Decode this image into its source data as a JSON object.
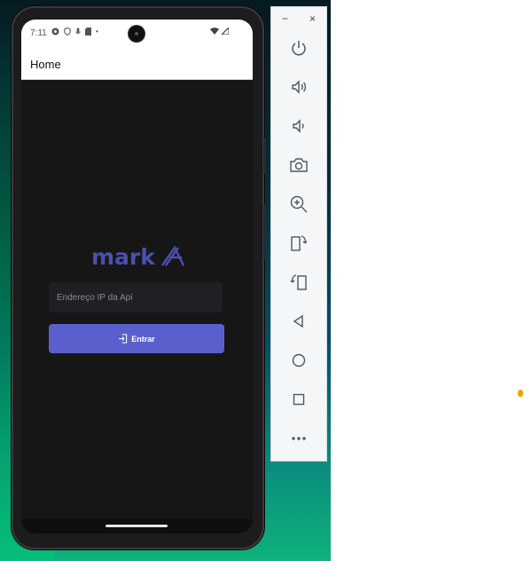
{
  "status_bar": {
    "time": "7:11"
  },
  "app": {
    "title": "Home",
    "logo_text": "markX",
    "ip_field": {
      "placeholder": "Endereço IP da Api",
      "value": ""
    },
    "enter_button_label": "Entrar"
  },
  "emulator_toolbar": {
    "window_controls": [
      "−",
      "×"
    ],
    "buttons": [
      {
        "name": "power-icon",
        "label": "Power"
      },
      {
        "name": "volume-up-icon",
        "label": "Volume up"
      },
      {
        "name": "volume-down-icon",
        "label": "Volume down"
      },
      {
        "name": "camera-icon",
        "label": "Take screenshot"
      },
      {
        "name": "zoom-icon",
        "label": "Zoom"
      },
      {
        "name": "rotate-left-icon",
        "label": "Rotate left"
      },
      {
        "name": "rotate-right-icon",
        "label": "Rotate right"
      },
      {
        "name": "back-icon",
        "label": "Back"
      },
      {
        "name": "home-icon",
        "label": "Home"
      },
      {
        "name": "overview-icon",
        "label": "Overview"
      },
      {
        "name": "more-icon",
        "label": "More"
      }
    ]
  },
  "colors": {
    "accent": "#5b5fce",
    "logo": "#4a4fb0",
    "screen_bg": "#161616"
  }
}
